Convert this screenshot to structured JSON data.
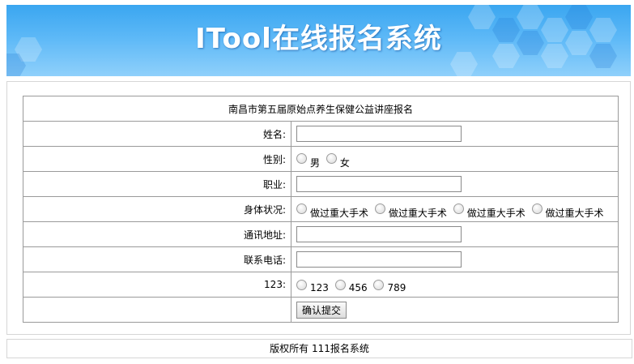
{
  "banner": {
    "title": "ITool在线报名系统"
  },
  "form": {
    "heading": "南昌市第五届原始点养生保健公益讲座报名",
    "name": {
      "label": "姓名:",
      "value": ""
    },
    "gender": {
      "label": "性别:",
      "options": [
        "男",
        "女"
      ]
    },
    "job": {
      "label": "职业:",
      "value": ""
    },
    "health": {
      "label": "身体状况:",
      "options": [
        "做过重大手术",
        "做过重大手术",
        "做过重大手术",
        "做过重大手术"
      ]
    },
    "address": {
      "label": "通讯地址:",
      "value": ""
    },
    "phone": {
      "label": "联系电话:",
      "value": ""
    },
    "extra": {
      "label": "123:",
      "options": [
        "123",
        "456",
        "789"
      ]
    },
    "submit_label": "确认提交"
  },
  "footer": {
    "text": "版权所有 111报名系统"
  },
  "colors": {
    "banner": "#3aa6f0"
  }
}
